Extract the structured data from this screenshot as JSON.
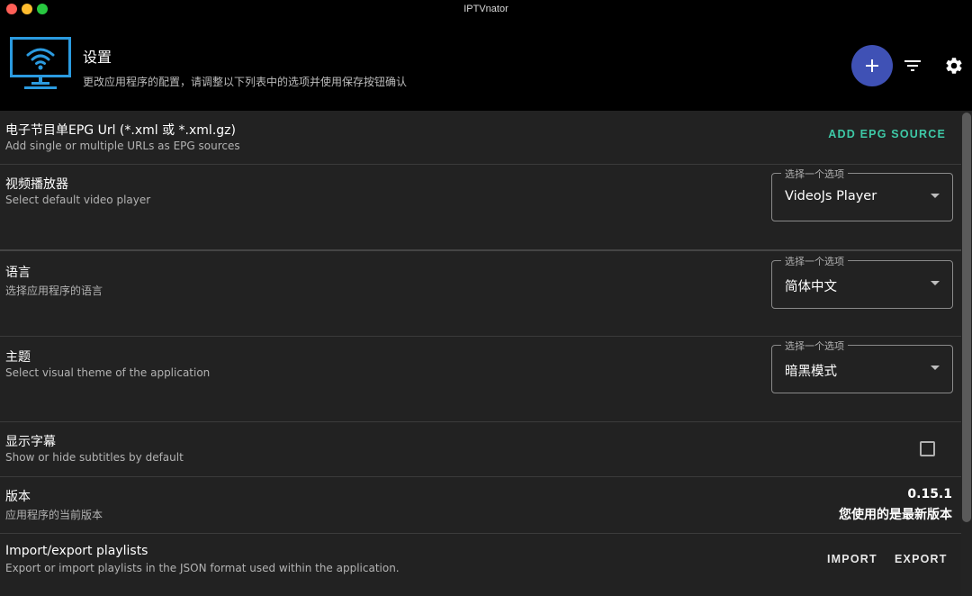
{
  "window": {
    "title": "IPTVnator"
  },
  "header": {
    "title": "设置",
    "subtitle": "更改应用程序的配置，请调整以下列表中的选项并使用保存按钮确认"
  },
  "settings": {
    "epg": {
      "title": "电子节目单EPG Url (*.xml 或 *.xml.gz)",
      "subtitle": "Add single or multiple URLs as EPG sources",
      "button_label": "ADD EPG SOURCE"
    },
    "video_player": {
      "title": "视频播放器",
      "subtitle": "Select default video player",
      "select_label": "选择一个选项",
      "select_value": "VideoJs Player"
    },
    "language": {
      "title": "语言",
      "subtitle": "选择应用程序的语言",
      "select_label": "选择一个选项",
      "select_value": "简体中文"
    },
    "theme": {
      "title": "主题",
      "subtitle": "Select visual theme of the application",
      "select_label": "选择一个选项",
      "select_value": "暗黑模式"
    },
    "subtitles": {
      "title": "显示字幕",
      "subtitle": "Show or hide subtitles by default",
      "checked": false
    },
    "version": {
      "title": "版本",
      "subtitle": "应用程序的当前版本",
      "number": "0.15.1",
      "status": "您使用的是最新版本"
    },
    "import_export": {
      "title": "Import/export playlists",
      "subtitle": "Export or import playlists in the JSON format used within the application.",
      "import_label": "IMPORT",
      "export_label": "EXPORT"
    }
  },
  "icons": {
    "logo": "tv-wifi-icon",
    "add": "plus-icon",
    "filter": "filter-list-icon",
    "settings": "gear-icon",
    "dropdown": "arrow-drop-down-icon"
  },
  "colors": {
    "header_bg": "#000000",
    "content_bg": "#222222",
    "accent_primary": "#3f51b5",
    "accent_teal": "#3ec9a7",
    "logo_blue": "#2b9be0"
  }
}
